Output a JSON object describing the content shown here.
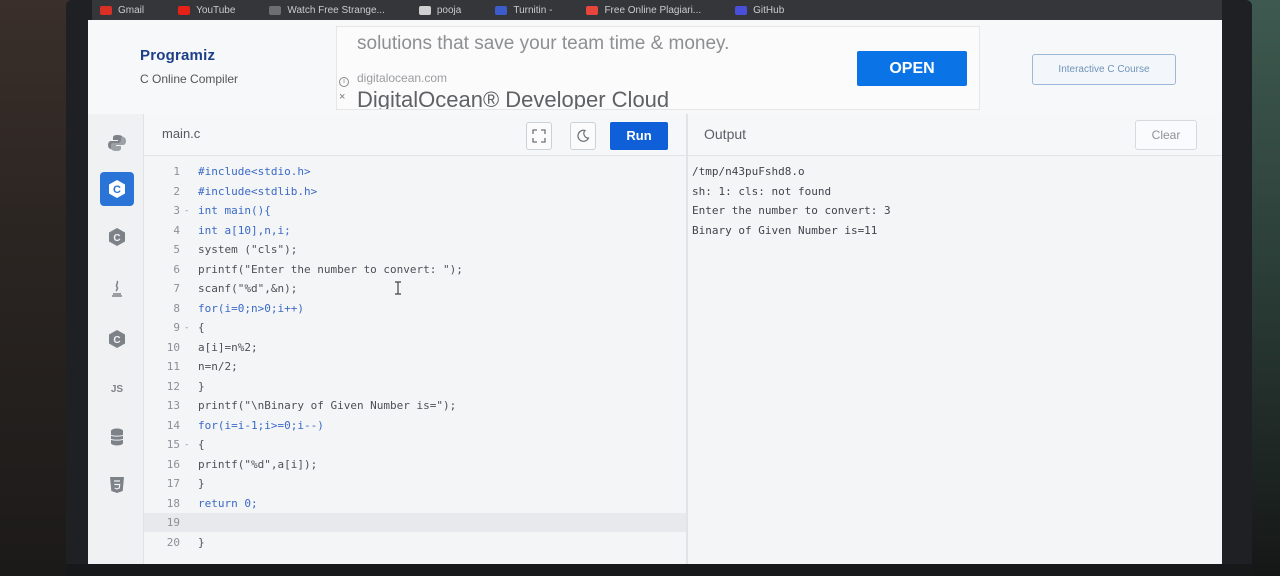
{
  "browser": {
    "bookmarks": [
      {
        "label": "Gmail",
        "color": "#d93025"
      },
      {
        "label": "YouTube",
        "color": "#e62117"
      },
      {
        "label": "Watch Free Strange...",
        "color": "#6b6e73"
      },
      {
        "label": "pooja",
        "color": "#d0d0d0"
      },
      {
        "label": "Turnitin -",
        "color": "#3b5cc9"
      },
      {
        "label": "Free Online Plagiari...",
        "color": "#e8453c"
      },
      {
        "label": "GitHub",
        "color": "#4a4fd9"
      }
    ]
  },
  "header": {
    "logo": "Programiz",
    "subtitle": "C Online Compiler",
    "ad": {
      "headline": "solutions that save your team time & money.",
      "domain": "digitalocean.com",
      "title": "DigitalOcean® Developer Cloud",
      "cta": "OPEN",
      "close": "×"
    },
    "course_button": "Interactive C Course"
  },
  "sidebar": {
    "items": [
      {
        "name": "python",
        "active": false
      },
      {
        "name": "c",
        "active": true
      },
      {
        "name": "cpp",
        "active": false
      },
      {
        "name": "java",
        "active": false
      },
      {
        "name": "csharp",
        "active": false
      },
      {
        "name": "js",
        "label": "JS",
        "active": false
      },
      {
        "name": "sql",
        "active": false
      },
      {
        "name": "html",
        "active": false
      }
    ]
  },
  "editor": {
    "filename": "main.c",
    "run_label": "Run",
    "current_line": 19,
    "lines": [
      {
        "n": "1",
        "fold": "",
        "text": "#include<stdio.h>"
      },
      {
        "n": "2",
        "fold": "",
        "text": "#include<stdlib.h>"
      },
      {
        "n": "3",
        "fold": "-",
        "text": "int main(){"
      },
      {
        "n": "4",
        "fold": "",
        "text": "int a[10],n,i;"
      },
      {
        "n": "5",
        "fold": "",
        "text": "system (\"cls\");"
      },
      {
        "n": "6",
        "fold": "",
        "text": "printf(\"Enter the number to convert: \");"
      },
      {
        "n": "7",
        "fold": "",
        "text": "scanf(\"%d\",&n);"
      },
      {
        "n": "8",
        "fold": "",
        "text": "for(i=0;n>0;i++)"
      },
      {
        "n": "9",
        "fold": "-",
        "text": "{"
      },
      {
        "n": "10",
        "fold": "",
        "text": "a[i]=n%2;"
      },
      {
        "n": "11",
        "fold": "",
        "text": "n=n/2;"
      },
      {
        "n": "12",
        "fold": "",
        "text": "}"
      },
      {
        "n": "13",
        "fold": "",
        "text": "printf(\"\\nBinary of Given Number is=\");"
      },
      {
        "n": "14",
        "fold": "",
        "text": "for(i=i-1;i>=0;i--)"
      },
      {
        "n": "15",
        "fold": "-",
        "text": "{"
      },
      {
        "n": "16",
        "fold": "",
        "text": "printf(\"%d\",a[i]);"
      },
      {
        "n": "17",
        "fold": "",
        "text": "}"
      },
      {
        "n": "18",
        "fold": "",
        "text": "return 0;"
      },
      {
        "n": "19",
        "fold": "",
        "text": ""
      },
      {
        "n": "20",
        "fold": "",
        "text": "}"
      }
    ]
  },
  "output": {
    "title": "Output",
    "clear_label": "Clear",
    "lines": [
      "/tmp/n43puFshd8.o",
      "sh: 1: cls: not found",
      "Enter the number to convert: 3",
      "Binary of Given Number is=11"
    ]
  }
}
